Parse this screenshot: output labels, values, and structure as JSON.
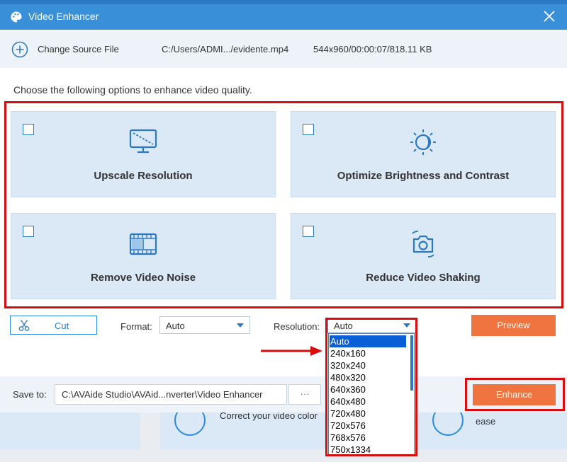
{
  "background": {
    "card_left_text": "",
    "card_right_text": "Correct your video color",
    "card_far_right_text": "ease"
  },
  "titlebar": {
    "title": "Video Enhancer",
    "icon": "palette-icon",
    "close_icon": "close-icon"
  },
  "source": {
    "change_label": "Change Source File",
    "path": "C:/Users/ADMI.../evidente.mp4",
    "info": "544x960/00:00:07/818.11 KB"
  },
  "instructions": "Choose the following options to enhance video quality.",
  "options": [
    {
      "label": "Upscale Resolution",
      "icon": "monitor-upscale-icon",
      "checked": false
    },
    {
      "label": "Optimize Brightness and Contrast",
      "icon": "brightness-icon",
      "checked": false
    },
    {
      "label": "Remove Video Noise",
      "icon": "film-noise-icon",
      "checked": false
    },
    {
      "label": "Reduce Video Shaking",
      "icon": "camera-stabilize-icon",
      "checked": false
    }
  ],
  "toolbar": {
    "cut_label": "Cut",
    "format_label": "Format:",
    "format_value": "Auto",
    "resolution_label": "Resolution:",
    "resolution_value": "Auto",
    "preview_label": "Preview"
  },
  "resolution_options": [
    "Auto",
    "240x160",
    "320x240",
    "480x320",
    "640x360",
    "640x480",
    "720x480",
    "720x576",
    "768x576",
    "750x1334"
  ],
  "save": {
    "label": "Save to:",
    "path": "C:\\AVAide Studio\\AVAid...nverter\\Video Enhancer",
    "browse_label": "···",
    "enhance_label": "Enhance"
  },
  "colors": {
    "accent": "#3a8fd9",
    "button_orange": "#f0743f",
    "highlight_red": "#d50f0f",
    "option_bg": "#dbe9f7"
  }
}
